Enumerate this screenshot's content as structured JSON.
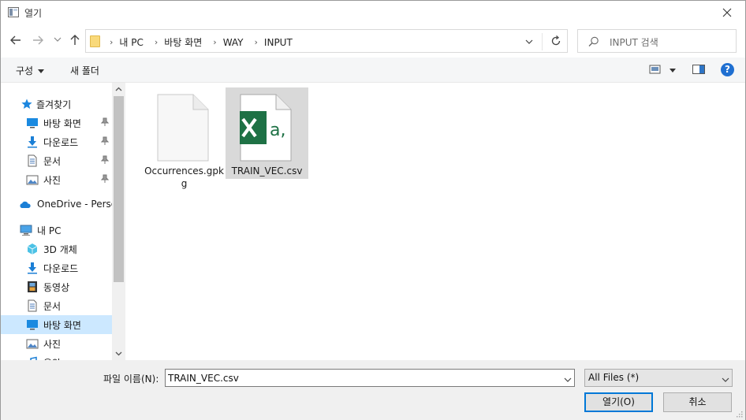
{
  "window": {
    "title": "열기",
    "close_icon": "close-icon"
  },
  "address": {
    "breadcrumbs": [
      "내 PC",
      "바탕 화면",
      "WAY",
      "INPUT"
    ],
    "search_placeholder": "INPUT 검색"
  },
  "toolbar": {
    "organize_label": "구성",
    "new_folder_label": "새 폴더",
    "help_label": "?"
  },
  "nav": {
    "quick_access_label": "즐겨찾기",
    "quick_items": [
      {
        "label": "바탕 화면",
        "icon": "desktop-icon",
        "pinned": true
      },
      {
        "label": "다운로드",
        "icon": "download-icon",
        "pinned": true
      },
      {
        "label": "문서",
        "icon": "document-icon",
        "pinned": true
      },
      {
        "label": "사진",
        "icon": "pictures-icon",
        "pinned": true
      }
    ],
    "onedrive_label": "OneDrive - Personal",
    "thispc_label": "내 PC",
    "pc_items": [
      {
        "label": "3D 개체",
        "icon": "3d-objects-icon"
      },
      {
        "label": "다운로드",
        "icon": "download-icon"
      },
      {
        "label": "동영상",
        "icon": "video-icon"
      },
      {
        "label": "문서",
        "icon": "document-icon"
      },
      {
        "label": "바탕 화면",
        "icon": "desktop-icon",
        "selected": true
      },
      {
        "label": "사진",
        "icon": "pictures-icon"
      },
      {
        "label": "음악",
        "icon": "music-icon"
      }
    ]
  },
  "files": [
    {
      "name": "Occurrences.gpkg",
      "icon": "generic-file-icon",
      "selected": false
    },
    {
      "name": "TRAIN_VEC.csv",
      "icon": "excel-csv-icon",
      "selected": true
    }
  ],
  "footer": {
    "filename_label": "파일 이름(N):",
    "filename_value": "TRAIN_VEC.csv",
    "filetype_value": "All Files (*)",
    "open_label": "열기(O)",
    "cancel_label": "취소"
  },
  "colors": {
    "selection": "#cce8ff",
    "file_selection": "#d9d9d9",
    "excel_green": "#1e7145",
    "accent": "#0078d7"
  }
}
